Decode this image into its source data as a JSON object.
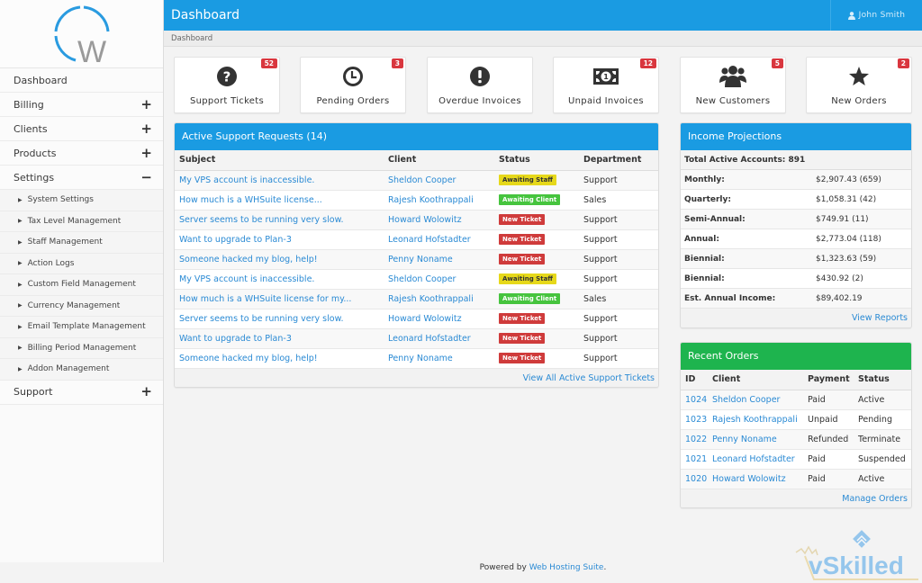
{
  "app": {
    "title": "Dashboard",
    "breadcrumb": "Dashboard",
    "user": "John Smith"
  },
  "sidebar": {
    "items": [
      {
        "label": "Dashboard",
        "expander": ""
      },
      {
        "label": "Billing",
        "expander": "+"
      },
      {
        "label": "Clients",
        "expander": "+"
      },
      {
        "label": "Products",
        "expander": "+"
      },
      {
        "label": "Settings",
        "expander": "−"
      }
    ],
    "settings_sub": [
      "System Settings",
      "Tax Level Management",
      "Staff Management",
      "Action Logs",
      "Custom Field Management",
      "Currency Management",
      "Email Template Management",
      "Billing Period Management",
      "Addon Management"
    ],
    "support": {
      "label": "Support",
      "expander": "+"
    }
  },
  "tiles": [
    {
      "label": "Support Tickets",
      "badge": "52",
      "icon": "question-circle-icon"
    },
    {
      "label": "Pending Orders",
      "badge": "3",
      "icon": "clock-icon"
    },
    {
      "label": "Overdue Invoices",
      "badge": "",
      "icon": "exclamation-circle-icon"
    },
    {
      "label": "Unpaid Invoices",
      "badge": "12",
      "icon": "money-bill-icon"
    },
    {
      "label": "New Customers",
      "badge": "5",
      "icon": "users-icon"
    },
    {
      "label": "New Orders",
      "badge": "2",
      "icon": "star-icon"
    }
  ],
  "support": {
    "title": "Active Support Requests (14)",
    "columns": [
      "Subject",
      "Client",
      "Status",
      "Department"
    ],
    "rows": [
      [
        "My VPS account is inaccessible.",
        "Sheldon Cooper",
        "Awaiting Staff",
        "Support"
      ],
      [
        "How much is a WHSuite license...",
        "Rajesh Koothrappali",
        "Awaiting Client",
        "Sales"
      ],
      [
        "Server seems to be running very slow.",
        "Howard Wolowitz",
        "New Ticket",
        "Support"
      ],
      [
        "Want to upgrade to Plan-3",
        "Leonard Hofstadter",
        "New Ticket",
        "Support"
      ],
      [
        "Someone hacked my blog, help!",
        "Penny Noname",
        "New Ticket",
        "Support"
      ],
      [
        "My VPS account is inaccessible.",
        "Sheldon Cooper",
        "Awaiting Staff",
        "Support"
      ],
      [
        "How much is a WHSuite license for my...",
        "Rajesh Koothrappali",
        "Awaiting Client",
        "Sales"
      ],
      [
        "Server seems to be running very slow.",
        "Howard Wolowitz",
        "New Ticket",
        "Support"
      ],
      [
        "Want to upgrade to Plan-3",
        "Leonard Hofstadter",
        "New Ticket",
        "Support"
      ],
      [
        "Someone hacked my blog, help!",
        "Penny Noname",
        "New Ticket",
        "Support"
      ]
    ],
    "footer_link": "View All Active Support Tickets"
  },
  "income": {
    "title": "Income Projections",
    "total": "Total Active Accounts: 891",
    "rows": [
      [
        "Monthly:",
        "$2,907.43 (659)"
      ],
      [
        "Quarterly:",
        "$1,058.31 (42)"
      ],
      [
        "Semi-Annual:",
        "$749.91 (11)"
      ],
      [
        "Annual:",
        "$2,773.04 (118)"
      ],
      [
        "Biennial:",
        "$1,323.63 (59)"
      ],
      [
        "Biennial:",
        "$430.92 (2)"
      ],
      [
        "Est. Annual Income:",
        "$89,402.19"
      ]
    ],
    "footer_link": "View Reports"
  },
  "orders": {
    "title": "Recent Orders",
    "columns": [
      "ID",
      "Client",
      "Payment",
      "Status"
    ],
    "rows": [
      [
        "1024",
        "Sheldon Cooper",
        "Paid",
        "Active"
      ],
      [
        "1023",
        "Rajesh Koothrappali",
        "Unpaid",
        "Pending"
      ],
      [
        "1022",
        "Penny Noname",
        "Refunded",
        "Terminate"
      ],
      [
        "1021",
        "Leonard Hofstadter",
        "Paid",
        "Suspended"
      ],
      [
        "1020",
        "Howard Wolowitz",
        "Paid",
        "Active"
      ]
    ],
    "footer_link": "Manage Orders"
  },
  "footer": {
    "prefix": "Powered by ",
    "link": "Web Hosting Suite",
    "suffix": "."
  },
  "watermark": "vSkilled",
  "colors": {
    "primary": "#1a9be2",
    "success": "#1eb44e",
    "danger": "#d9363e",
    "warning": "#e6d81a",
    "link": "#2a8ad4"
  }
}
